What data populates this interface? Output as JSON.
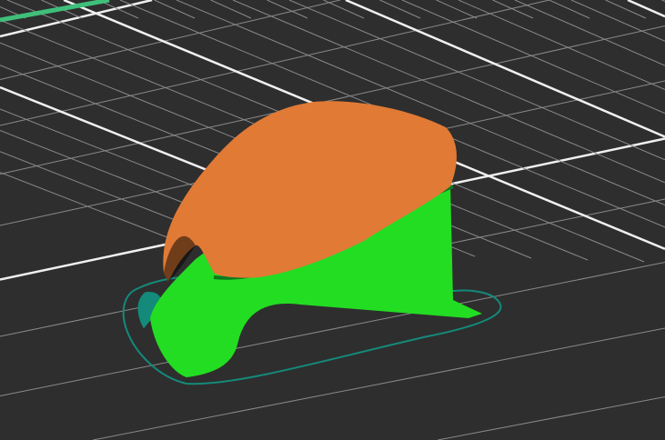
{
  "viewport": {
    "background": "#2e2e2e",
    "grid_minor": "#8a8a8a",
    "grid_major": "#f0f0f0",
    "bed_edge": "#3fbf7a"
  },
  "model": {
    "infill_color": "#22dd22",
    "perimeter_dark": "#0f7a1e",
    "top_color": "#e07a35",
    "skirt_color": "#138a7a"
  }
}
